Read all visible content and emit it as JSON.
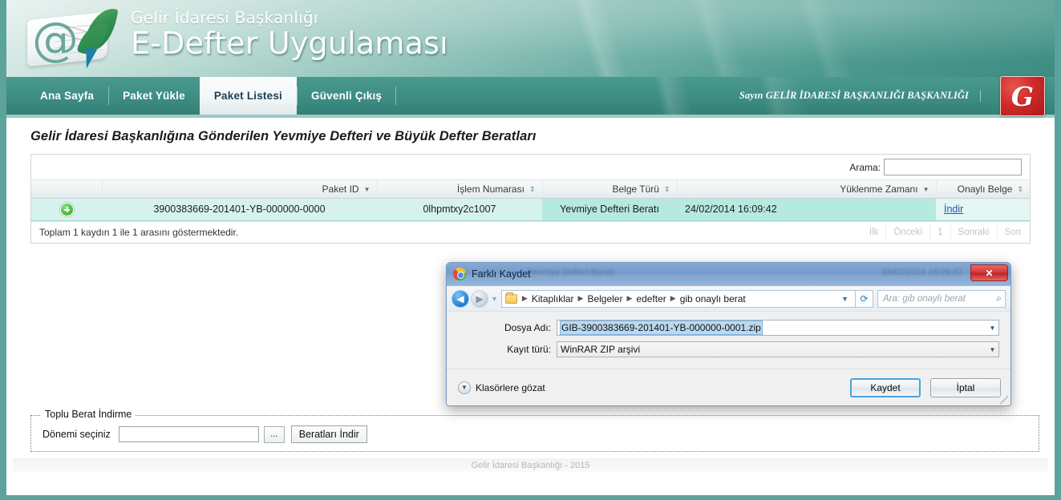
{
  "brand": {
    "line1": "Gelir İdaresi Başkanlığı",
    "line2": "E-Defter Uygulaması",
    "logo_icon": "at-ledger-quill-icon",
    "gib_logo_icon": "gib-logo-icon",
    "gib_logo_letter": "G"
  },
  "nav": {
    "tabs": [
      {
        "label": "Ana Sayfa",
        "active": false
      },
      {
        "label": "Paket Yükle",
        "active": false
      },
      {
        "label": "Paket Listesi",
        "active": true
      },
      {
        "label": "Güvenli Çıkış",
        "active": false
      }
    ],
    "user_greeting": "Sayın GELİR İDARESİ BAŞKANLIĞI BAŞKANLIĞI"
  },
  "page": {
    "title": "Gelir İdaresi Başkanlığına Gönderilen Yevmiye Defteri ve Büyük Defter Beratları"
  },
  "search": {
    "label": "Arama:",
    "value": "",
    "placeholder": ""
  },
  "grid": {
    "columns": [
      {
        "label": "",
        "sort": "none"
      },
      {
        "label": "Paket ID",
        "sort": "desc"
      },
      {
        "label": "İşlem Numarası",
        "sort": "both"
      },
      {
        "label": "Belge Türü",
        "sort": "both"
      },
      {
        "label": "Yüklenme Zamanı",
        "sort": "desc"
      },
      {
        "label": "Onaylı Belge",
        "sort": "both"
      }
    ],
    "rows": [
      {
        "expand_icon": "plus-circle-icon",
        "paket_id": "3900383669-201401-YB-000000-0000",
        "islem_numarasi": "0lhpmtxy2c1007",
        "belge_turu": "Yevmiye Defteri Beratı",
        "yuklenme_zamani": "24/02/2014 16:09:42",
        "onayli_belge": "İndir"
      }
    ],
    "record_info": "Toplam 1 kaydın 1 ile 1 arasını göstermektedir.",
    "pager": [
      "İlk",
      "Önceki",
      "1",
      "Sonraki",
      "Son"
    ]
  },
  "toplu": {
    "legend": "Toplu Berat İndirme",
    "period_label": "Dönemi seçiniz",
    "period_value": "",
    "browse_button": "...",
    "download_button": "Beratları İndir"
  },
  "footer": {
    "text": "Gelir İdaresi Başkanlığı - 2015"
  },
  "dialog": {
    "title": "Farklı Kaydet",
    "app_icon": "chrome-icon",
    "close_label": "✕",
    "ghost_left": "Yevmiye Defteri Beratı",
    "ghost_right": "24/02/2014 16:09:42",
    "nav": {
      "back_icon": "back-arrow-icon",
      "forward_icon": "forward-arrow-icon",
      "recent_caret_icon": "chevron-down-icon",
      "folder_icon": "folder-icon",
      "breadcrumb": [
        "Kitaplıklar",
        "Belgeler",
        "edefter",
        "gib onaylı berat"
      ],
      "breadcrumb_caret_icon": "chevron-down-icon",
      "refresh_icon": "refresh-icon",
      "search_placeholder": "Ara: gib onaylı berat",
      "search_icon": "search-icon"
    },
    "fields": {
      "filename_label": "Dosya Adı:",
      "filename_value": "GIB-3900383669-201401-YB-000000-0001.zip",
      "filetype_label": "Kayıt türü:",
      "filetype_value": "WinRAR ZIP arşivi",
      "caret_icon": "chevron-down-icon"
    },
    "footer": {
      "browse_folders": "Klasörlere gözat",
      "browse_icon": "chevron-down-circle-icon",
      "save_button": "Kaydet",
      "cancel_button": "İptal"
    }
  },
  "colors": {
    "teal": "#3f8f85",
    "teal_light": "#9ccbc4",
    "row_selected": "#b6e9e0",
    "link": "#2a4fb5",
    "gib_red": "#d22a2a",
    "dialog_blue": "#6f9ac4"
  }
}
